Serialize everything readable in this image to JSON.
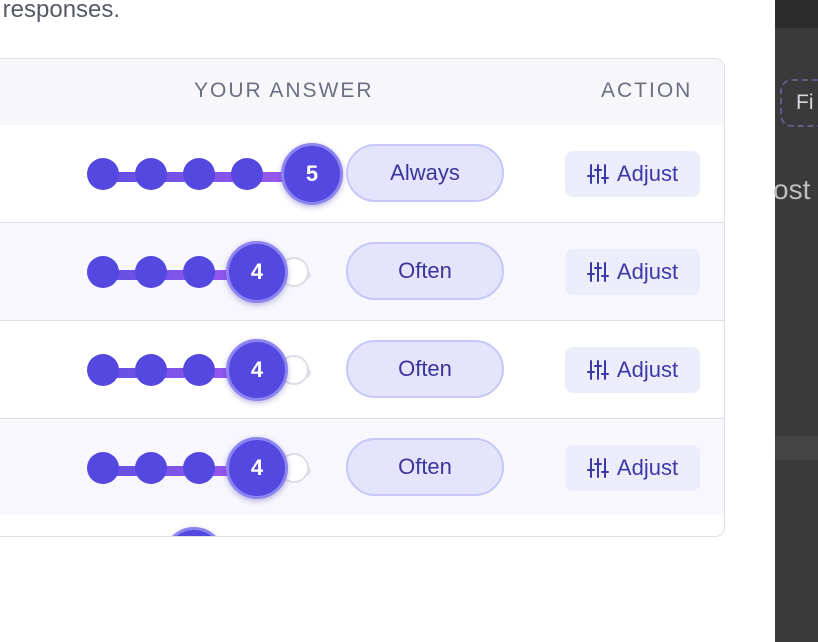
{
  "intro": {
    "text": "r responses."
  },
  "table": {
    "columns": {
      "answer": "YOUR ANSWER",
      "action": "ACTION"
    },
    "scale_max": 5,
    "rows": [
      {
        "value": 5,
        "value_label": "5",
        "answer": "Always",
        "action": "Adjust"
      },
      {
        "value": 4,
        "value_label": "4",
        "answer": "Often",
        "action": "Adjust"
      },
      {
        "value": 4,
        "value_label": "4",
        "answer": "Often",
        "action": "Adjust"
      },
      {
        "value": 4,
        "value_label": "4",
        "answer": "Often",
        "action": "Adjust"
      }
    ]
  },
  "side_panel": {
    "filter_label": "Fi",
    "text": "ost"
  },
  "colors": {
    "accent": "#5548e0",
    "pill_bg": "#e4e5fd",
    "panel_bg": "#3a3a3a"
  }
}
